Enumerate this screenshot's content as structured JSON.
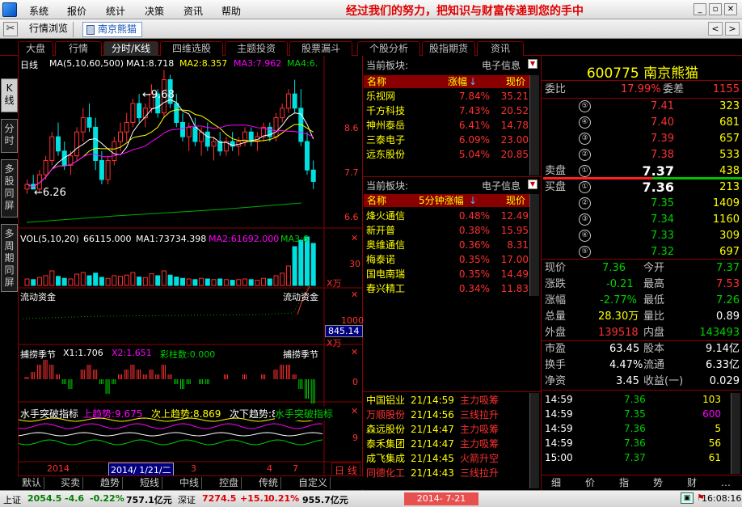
{
  "menu": {
    "items": [
      "系统",
      "报价",
      "统计",
      "决策",
      "资讯",
      "帮助"
    ],
    "slogan": "经过我们的努力，把知识与财富传递到您的手中"
  },
  "toolbar": {
    "tab1": "行情浏览",
    "tab2": "南京熊猫",
    "back": "<",
    "forward": ">"
  },
  "func_tabs": [
    "大盘",
    "行情",
    "分时/K线",
    "四维选股",
    "主题投资",
    "股票漏斗",
    "个股分析",
    "股指期货",
    "资讯"
  ],
  "side_tabs": [
    "K线",
    "分时",
    "多股同屏",
    "多周期同屏"
  ],
  "chart": {
    "main_title": "日线",
    "ma_label": "MA(5,10,60,500)",
    "ma1": "MA1:8.718",
    "ma2": "MA2:8.357",
    "ma3": "MA3:7.962",
    "ma4": "MA4:6.",
    "high_label": "9.68",
    "low_label": "6.26",
    "y_ticks": [
      "8.6",
      "7.7",
      "6.6"
    ],
    "vol_title": "VOL(5,10,20)",
    "vol_val": "66115.000",
    "vol_ma1": "MA1:73734.398",
    "vol_ma2": "MA2:61692.000",
    "vol_ma3": "MA3:6",
    "vol_tick": "30",
    "vol_unit": "X万",
    "flow_title": "流动资金",
    "flow_title_r": "流动资金",
    "flow_tick": "1000",
    "flow_cur": "845.14",
    "flow_unit": "X万",
    "season_title": "捕捞季节",
    "season_x1": "X1:1.706",
    "season_x2": "X2:1.651",
    "season_bar": "彩柱数:0.000",
    "season_title_r": "捕捞季节",
    "season_tick": "0",
    "water_title": "水手突破指标",
    "water_up": "上趋势:9.675",
    "water_up2": "次上趋势:8.869",
    "water_down": "次下趋势:8.682",
    "water_title_r": "水手突破指标",
    "water_tick": "9",
    "date_start": "2014",
    "date_sel": "2014/ 1/21/二",
    "date_m3": "3",
    "date_m4": "4",
    "date_m7": "7",
    "period": "日 线",
    "candles": [
      [
        7.2,
        7.4,
        7.1,
        7.3
      ],
      [
        7.3,
        7.5,
        7.2,
        7.2
      ],
      [
        7.2,
        7.6,
        7.1,
        7.5
      ],
      [
        7.5,
        7.9,
        7.4,
        7.8
      ],
      [
        7.8,
        8.4,
        7.7,
        8.3
      ],
      [
        8.3,
        8.6,
        7.9,
        8.0
      ],
      [
        8.0,
        8.2,
        7.6,
        7.7
      ],
      [
        7.7,
        8.0,
        7.5,
        7.9
      ],
      [
        7.9,
        8.5,
        7.8,
        8.4
      ],
      [
        8.4,
        8.9,
        8.2,
        8.7
      ],
      [
        8.7,
        9.0,
        8.4,
        8.5
      ],
      [
        8.5,
        8.7,
        7.6,
        7.8
      ],
      [
        7.8,
        8.0,
        7.3,
        7.4
      ],
      [
        7.4,
        7.9,
        7.3,
        7.8
      ],
      [
        7.8,
        8.3,
        7.7,
        8.2
      ],
      [
        8.2,
        8.6,
        8.0,
        8.4
      ],
      [
        8.4,
        8.8,
        8.2,
        8.6
      ],
      [
        8.6,
        9.1,
        8.5,
        9.0
      ],
      [
        9.0,
        9.2,
        8.6,
        8.7
      ],
      [
        8.7,
        9.0,
        8.5,
        8.9
      ],
      [
        8.9,
        9.4,
        8.8,
        9.2
      ],
      [
        9.2,
        9.3,
        8.7,
        8.8
      ],
      [
        8.8,
        9.7,
        8.7,
        9.5
      ],
      [
        9.5,
        9.6,
        8.9,
        9.0
      ],
      [
        9.0,
        9.2,
        8.5,
        8.6
      ],
      [
        8.6,
        8.8,
        8.2,
        8.3
      ],
      [
        8.3,
        8.6,
        8.0,
        8.5
      ],
      [
        8.5,
        8.7,
        8.1,
        8.2
      ],
      [
        8.2,
        8.5,
        7.9,
        8.4
      ],
      [
        8.4,
        8.6,
        8.0,
        8.1
      ],
      [
        8.1,
        8.3,
        7.8,
        8.2
      ],
      [
        8.2,
        8.4,
        7.9,
        8.0
      ],
      [
        8.0,
        8.3,
        7.9,
        8.2
      ],
      [
        8.2,
        8.4,
        8.0,
        8.1
      ],
      [
        8.1,
        8.3,
        7.9,
        8.2
      ],
      [
        8.2,
        8.5,
        8.1,
        8.4
      ],
      [
        8.4,
        8.5,
        8.1,
        8.2
      ],
      [
        8.2,
        8.4,
        8.0,
        8.3
      ],
      [
        8.3,
        8.6,
        8.2,
        8.5
      ],
      [
        8.5,
        8.6,
        8.2,
        8.3
      ],
      [
        8.3,
        8.8,
        8.2,
        8.7
      ],
      [
        8.7,
        9.0,
        8.6,
        8.9
      ],
      [
        8.9,
        9.3,
        8.8,
        9.2
      ],
      [
        9.2,
        9.5,
        8.8,
        8.9
      ],
      [
        8.9,
        9.3,
        8.1,
        8.2
      ],
      [
        8.2,
        8.4,
        7.5,
        7.6
      ],
      [
        7.6,
        7.8,
        7.2,
        7.36
      ]
    ],
    "volumes": [
      20,
      18,
      25,
      30,
      45,
      28,
      22,
      20,
      35,
      40,
      30,
      38,
      25,
      22,
      30,
      28,
      32,
      40,
      26,
      24,
      36,
      30,
      45,
      32,
      26,
      22,
      20,
      18,
      22,
      20,
      18,
      20,
      18,
      16,
      18,
      20,
      18,
      16,
      22,
      20,
      30,
      38,
      60,
      120,
      140,
      150,
      130
    ],
    "season": [
      0.5,
      1.5,
      3,
      4,
      3,
      1,
      -1,
      -2,
      0,
      2,
      3,
      2,
      -1,
      -3,
      -1,
      1,
      2,
      3,
      2,
      1,
      2,
      1,
      3,
      1,
      -1,
      -2,
      -1,
      0,
      -1,
      -1,
      0,
      0,
      1,
      0,
      0,
      1,
      0,
      0,
      1,
      0,
      2,
      3,
      3,
      1,
      -2,
      -4,
      -5
    ]
  },
  "board1": {
    "label": "当前板块:",
    "name": "电子信息",
    "cols": [
      "名称",
      "涨幅",
      "现价"
    ],
    "rows": [
      [
        "乐视网",
        "7.84%",
        "35.21"
      ],
      [
        "千方科技",
        "7.43%",
        "20.52"
      ],
      [
        "神州泰岳",
        "6.41%",
        "14.78"
      ],
      [
        "三泰电子",
        "6.09%",
        "23.00"
      ],
      [
        "远东股份",
        "5.04%",
        "20.85"
      ]
    ]
  },
  "board2": {
    "label": "当前板块:",
    "name": "电子信息",
    "cols": [
      "名称",
      "5分钟涨幅",
      "现价"
    ],
    "rows": [
      [
        "烽火通信",
        "0.48%",
        "12.49"
      ],
      [
        "新开普",
        "0.38%",
        "15.95"
      ],
      [
        "奥维通信",
        "0.36%",
        "8.31"
      ],
      [
        "梅泰诺",
        "0.35%",
        "17.00"
      ],
      [
        "国电南瑞",
        "0.35%",
        "14.49"
      ],
      [
        "春兴精工",
        "0.34%",
        "11.83"
      ]
    ]
  },
  "events": [
    [
      "中国铝业",
      "21/14:59",
      "主力吸筹"
    ],
    [
      "万顺股份",
      "21/14:56",
      "三线拉升"
    ],
    [
      "森远股份",
      "21/14:47",
      "主力吸筹"
    ],
    [
      "泰禾集团",
      "21/14:47",
      "主力吸筹"
    ],
    [
      "成飞集成",
      "21/14:45",
      "火箭升空"
    ],
    [
      "同德化工",
      "21/14:43",
      "三线拉升"
    ]
  ],
  "quote": {
    "code": "600775",
    "name": "南京熊猫",
    "wb_k": "委比",
    "wb": "17.99%",
    "wc_k": "委差",
    "wc": "1155",
    "sell_k": "卖盘",
    "buy_k": "买盘",
    "sells": [
      [
        "⑤",
        "7.41",
        "323"
      ],
      [
        "④",
        "7.40",
        "681"
      ],
      [
        "③",
        "7.39",
        "657"
      ],
      [
        "②",
        "7.38",
        "533"
      ],
      [
        "①",
        "7.37",
        "438"
      ]
    ],
    "buys": [
      [
        "①",
        "7.36",
        "213"
      ],
      [
        "②",
        "7.35",
        "1409"
      ],
      [
        "③",
        "7.34",
        "1160"
      ],
      [
        "④",
        "7.33",
        "309"
      ],
      [
        "⑤",
        "7.32",
        "697"
      ]
    ],
    "stats": [
      [
        "现价",
        "7.36",
        "今开",
        "7.37"
      ],
      [
        "涨跌",
        "-0.21",
        "最高",
        "7.53"
      ],
      [
        "涨幅",
        "-2.77%",
        "最低",
        "7.26"
      ],
      [
        "总量",
        "28.30万",
        "量比",
        "0.89"
      ],
      [
        "外盘",
        "139518",
        "内盘",
        "143493"
      ],
      [
        "市盈",
        "63.45",
        "股本",
        "9.14亿"
      ],
      [
        "换手",
        "4.47%",
        "流通",
        "6.33亿"
      ],
      [
        "净资",
        "3.45",
        "收益(一)",
        "0.029"
      ]
    ],
    "ticks": [
      [
        "14:59",
        "7.36",
        "103",
        "S"
      ],
      [
        "14:59",
        "7.35",
        "600",
        "S"
      ],
      [
        "14:59",
        "7.36",
        "5",
        "S"
      ],
      [
        "14:59",
        "7.36",
        "56",
        "S"
      ],
      [
        "15:00",
        "7.37",
        "61",
        "B"
      ]
    ],
    "tabs": [
      "细",
      "价",
      "指",
      "势",
      "财"
    ]
  },
  "bottom_tabs": [
    "默认",
    "买卖",
    "趋势",
    "短线",
    "中线",
    "控盘",
    "传统",
    "自定义"
  ],
  "status": {
    "sh_k": "上证",
    "sh": "2054.5",
    "sh_c": "-4.6",
    "sh_p": "-0.22%",
    "sh_a": "757.1亿元",
    "sz_k": "深证",
    "sz": "7274.5",
    "sz_c": "+15.1",
    "sz_p": "0.21%",
    "sz_a": "955.7亿元",
    "date": "2014- 7-21",
    "time": "16:08:16"
  },
  "colors": {
    "up": "#ff3030",
    "down": "#00d000",
    "frame": "#8a0000",
    "yellow": "#ffff00"
  }
}
